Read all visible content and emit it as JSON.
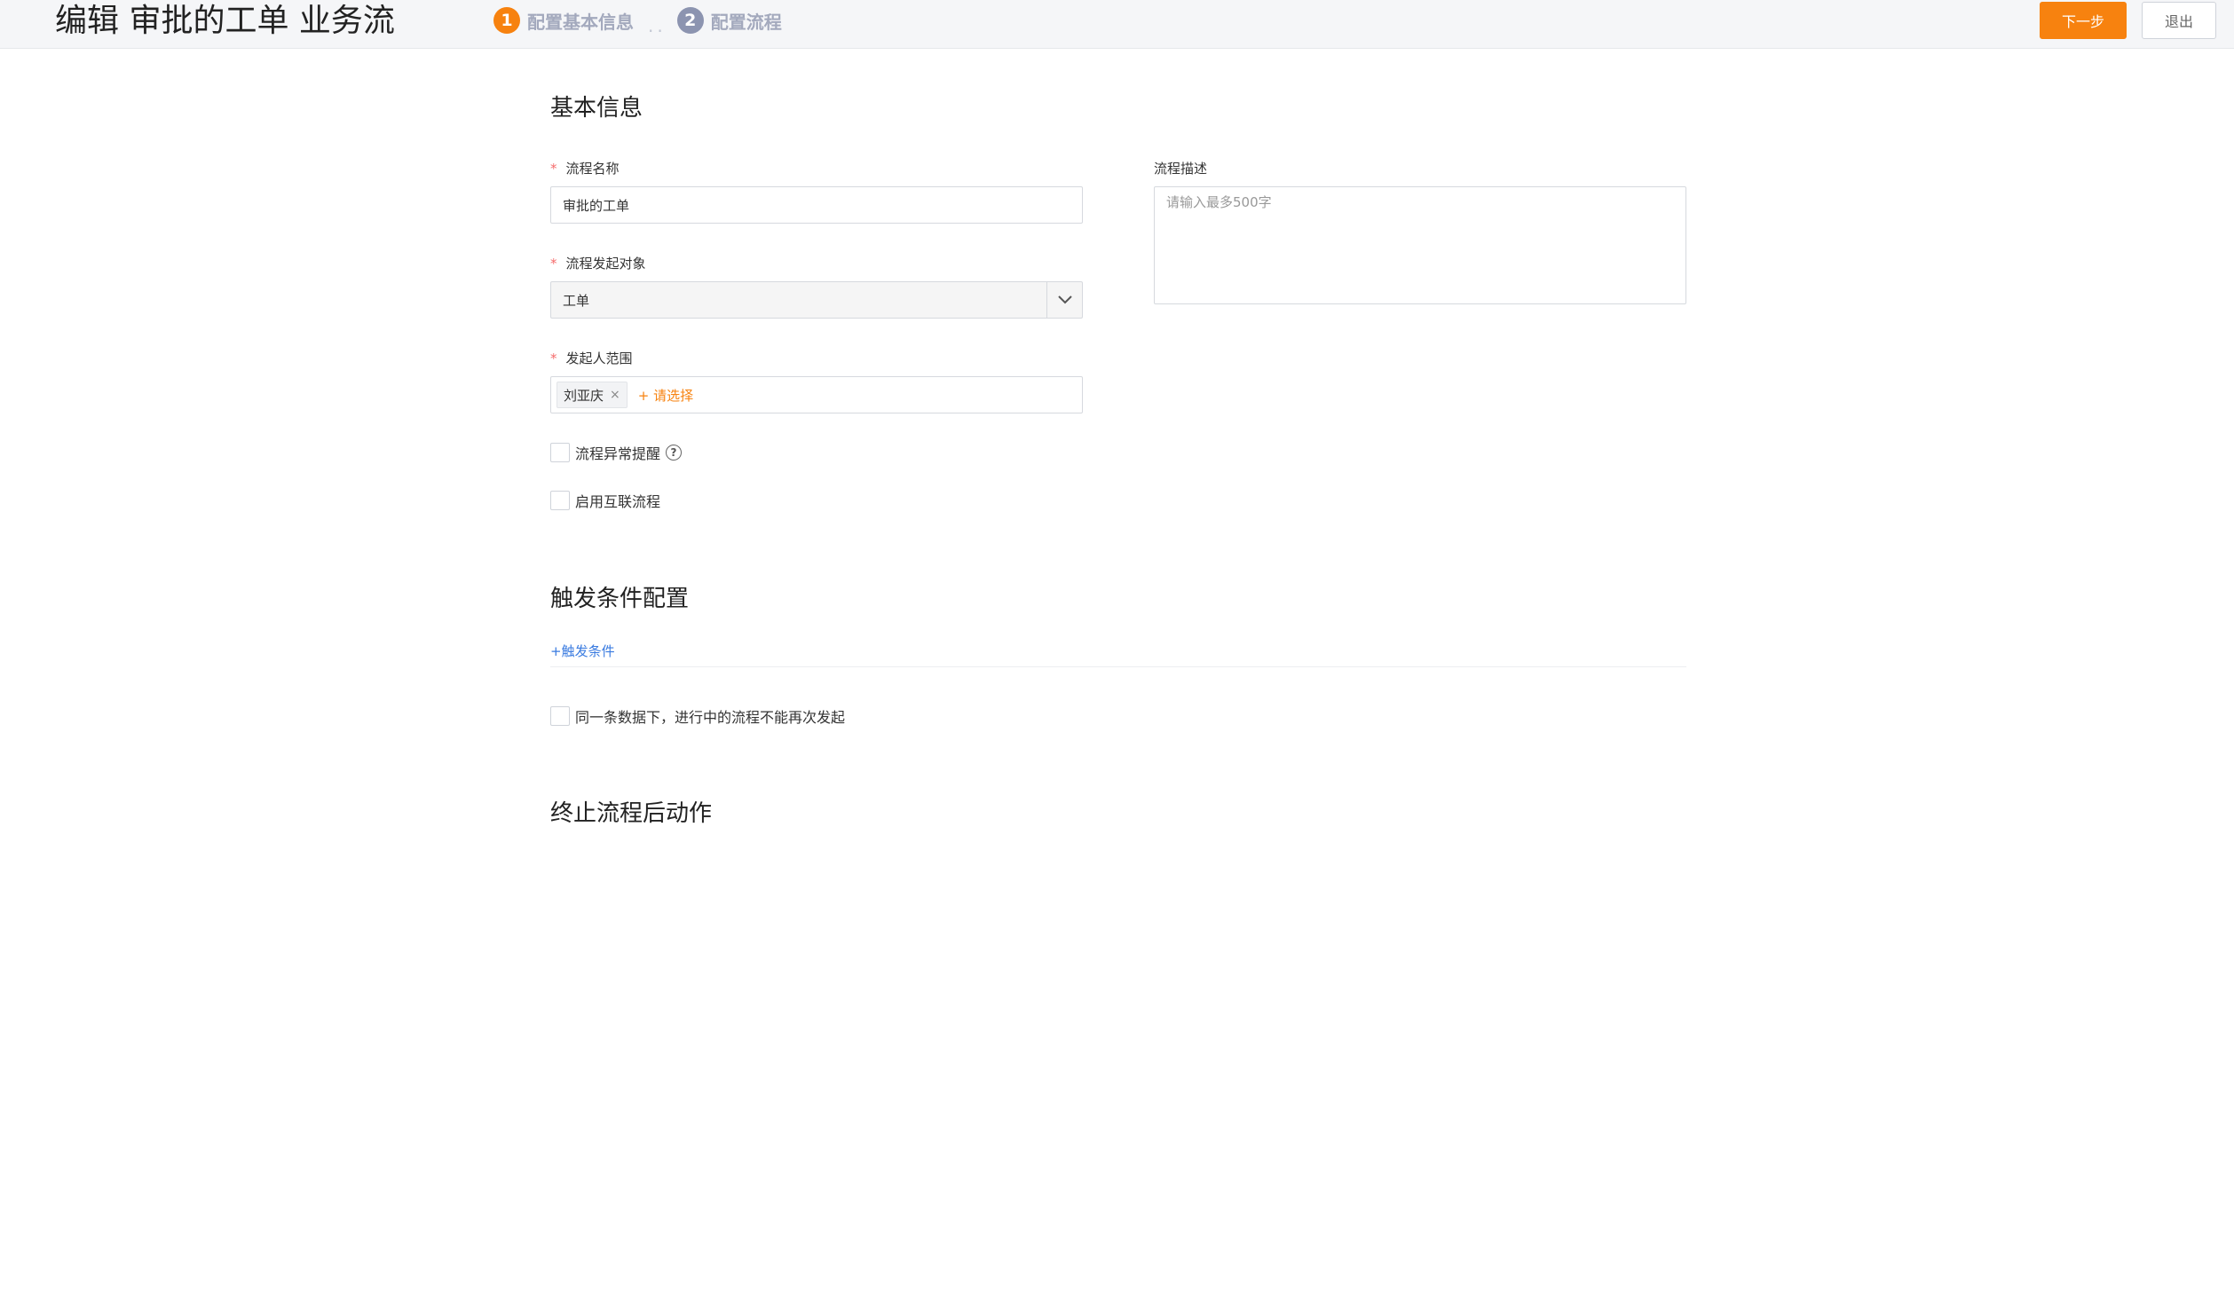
{
  "header": {
    "title": "编辑 审批的工单 业务流",
    "steps": [
      {
        "number": "1",
        "label": "配置基本信息",
        "active": true
      },
      {
        "number": "2",
        "label": "配置流程",
        "active": false
      }
    ],
    "step_separator": "..",
    "next_label": "下一步",
    "exit_label": "退出"
  },
  "basic_info": {
    "title": "基本信息",
    "process_name": {
      "label": "流程名称",
      "required_mark": "*",
      "value": "审批的工单"
    },
    "initiator_object": {
      "label": "流程发起对象",
      "required_mark": "*",
      "value": "工单"
    },
    "initiator_scope": {
      "label": "发起人范围",
      "required_mark": "*",
      "tag": "刘亚庆",
      "tag_close": "×",
      "add_label": "+ 请选择"
    },
    "description": {
      "label": "流程描述",
      "placeholder": "请输入最多500字"
    },
    "exception_alert": {
      "label": "流程异常提醒",
      "help": "?"
    },
    "interconnect": {
      "label": "启用互联流程"
    }
  },
  "trigger": {
    "title": "触发条件配置",
    "add_label": "+触发条件",
    "no_repeat": {
      "label": "同一条数据下，进行中的流程不能再次发起"
    }
  },
  "terminate": {
    "title": "终止流程后动作"
  },
  "colors": {
    "accent": "#f7820f",
    "link": "#3a7be0",
    "required": "#f56c6c"
  }
}
